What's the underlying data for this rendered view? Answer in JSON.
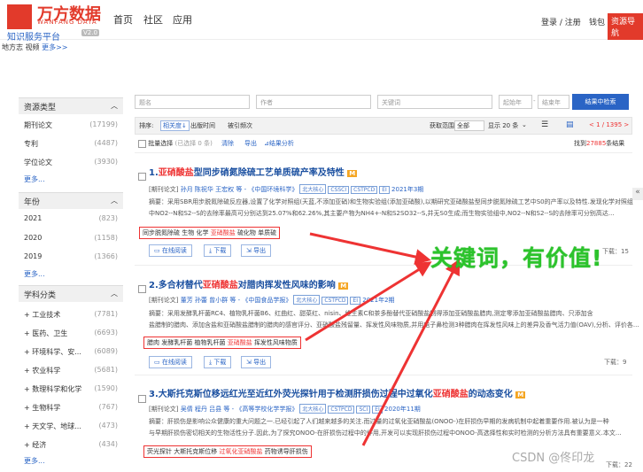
{
  "header": {
    "logo_main": "万方数据",
    "logo_sub": "WANFANG DATA",
    "platform": "知识服务平台",
    "version": "V2.0",
    "nav": [
      "首页",
      "社区",
      "应用"
    ],
    "login": "登录 / 注册",
    "wallet": "钱包",
    "guide": "资源导航"
  },
  "breadcrumb": {
    "text": "地方志 视频",
    "more": "更多>>"
  },
  "sidebar": {
    "resource_type": {
      "title": "资源类型",
      "items": [
        {
          "name": "期刊论文",
          "count": "(17199)"
        },
        {
          "name": "专利",
          "count": "(4487)"
        },
        {
          "name": "学位论文",
          "count": "(3930)"
        }
      ],
      "more": "更多..."
    },
    "year": {
      "title": "年份",
      "items": [
        {
          "name": "2021",
          "count": "(823)"
        },
        {
          "name": "2020",
          "count": "(1158)"
        },
        {
          "name": "2019",
          "count": "(1366)"
        }
      ],
      "more": "更多..."
    },
    "discipline": {
      "title": "学科分类",
      "items": [
        {
          "name": "+ 工业技术",
          "count": "(7781)"
        },
        {
          "name": "+ 医药、卫生",
          "count": "(6693)"
        },
        {
          "name": "+ 环境科学、安...",
          "count": "(6089)"
        },
        {
          "name": "+ 农业科学",
          "count": "(5681)"
        },
        {
          "name": "+ 数理科学和化学",
          "count": "(1590)"
        },
        {
          "name": "+ 生物科学",
          "count": "(767)"
        },
        {
          "name": "+ 天文学、地球...",
          "count": "(473)"
        },
        {
          "name": "+ 经济",
          "count": "(434)"
        }
      ],
      "more": "更多..."
    }
  },
  "search": {
    "title_ph": "题名",
    "author_ph": "作者",
    "keyword_ph": "关键词",
    "start_year_ph": "起始年",
    "end_year_ph": "结束年",
    "button": "结果中检索"
  },
  "toolbar": {
    "sort_label": "排序:",
    "sort_relevance": "相关度↓",
    "sort_date": "出版时间",
    "sort_cited": "被引频次",
    "fulltext": "获取范围",
    "fulltext_all": "全部",
    "display": "显示 20 条",
    "pager": "< 1 / 1395 >",
    "batch": "批量选择",
    "selected": "(已选择 0 条)",
    "clear": "清除",
    "export": "导出",
    "analysis": "结果分析",
    "found_pre": "找到",
    "found_count": "27885",
    "found_post": "条结果"
  },
  "results": [
    {
      "num": "1.",
      "title_hl": "亚硝酸盐",
      "title_rest": "型同步硝氮除硫工艺单质硫产率及特性",
      "meta_type": "[期刊论文]",
      "authors": "孙月  陈祝华  王宏权 等 - 《中国环境科学》",
      "tags": [
        "北大核心",
        "CSSCI",
        "CSTPCD",
        "EI"
      ],
      "date": "2021年3期",
      "abstract1": "摘要：采用SBR用步脱氮除硫反应器,设置了化学对照组(天蓝,不添加亚硝)和生物实验组(添加亚硝酸),以期研究亚硝酸盐型同步脱氮除硫工艺中S0的产率以及特性.发现化学对照组",
      "abstract2": "中NO2--N和S2--S的去除率最高可分别达到25.07%和62.26%,其主要产物为NH4+-N和S2SO32--S,并无S0生成;而生物实验组中,NO2--N和S2--S的去除率可分别高达...",
      "keywords": [
        "同步脱氮除硫",
        "生物",
        "化学",
        "亚硝酸盐",
        "硫化物",
        "单质硫"
      ],
      "kw_hl_index": 3,
      "online": "在线阅读",
      "download": "下载",
      "export": "导出",
      "downloads": "下载：15"
    },
    {
      "num": "2.",
      "title_hl": "",
      "title_pre": "多合材替代",
      "title_hl2": "亚硝酸盐",
      "title_rest": "对腊肉挥发性风味的影响",
      "meta_type": "[期刊论文]",
      "authors": "董芳  孙蕾  曾小群 等 - 《中国食品学报》",
      "tags": [
        "北大核心",
        "CSTPCD",
        "EI"
      ],
      "date": "2021年2期",
      "abstract1": "摘要：采用发酵乳杆菌RC4、植物乳杆菌B6、红曲红、甜菜红、nisin、维生素C和茶多酚替代亚硝酸盐制得添加亚硝酸盐腊肉,测定零添加亚硝酸盐腊肉、只添加含",
      "abstract2": "盐腊制的腊肉、添加含盐和亚硝酸盐腊制的腊肉的感官评分、亚硝酸盐残留量、挥发性风味物质,并用电子鼻检测3种腊肉在挥发性风味上的差异及香气活力值(OAV),分析、评价各...",
      "keywords": [
        "腊肉",
        "发酵乳杆菌",
        "植物乳杆菌",
        "亚硝酸盐",
        "挥发性风味物质"
      ],
      "kw_hl_index": 3,
      "online": "在线阅读",
      "download": "下载",
      "export": "导出",
      "downloads": "下载：9"
    },
    {
      "num": "3.",
      "title_pre": "大斯托克斯位移远红光至近红外荧光探针用于检测肝损伤过程中过氧化",
      "title_hl2": "亚硝酸盐",
      "title_rest": "的动态变化",
      "meta_type": "[期刊论文]",
      "authors": "吴倩  程丹  吕县 等 - 《高等学校化学学报》",
      "tags": [
        "北大核心",
        "CSTPCD",
        "SCI",
        "EI"
      ],
      "date": "2020年11期",
      "abstract1": "摘要：肝损伤是影响公众健康的重大问题之一.已经引起了人们越来越多的关注.而过量的过氧化亚硝酸盐(ONOO-)在肝损伤早期的发病机制中起着重要作用.被认为是一种",
      "abstract2": "与早期肝损伤密切相关的生物活性分子.因此,为了探究ONOO-在肝损伤过程中的作用,开发可以实现肝损伤过程中ONOO-高选择性和实时检测的分析方法具有重要意义.本文...",
      "keywords": [
        "荧光探针",
        "大斯托克斯位移",
        "过氧化亚硝酸盐",
        "药物诱导肝损伤"
      ],
      "kw_hl_index": 2,
      "online": "在线阅读",
      "download": "下载",
      "export": "导出",
      "downloads": "下载：22"
    }
  ],
  "annotation": "关键词，有价值!",
  "watermark": "CSDN @佟印龙",
  "colors": {
    "brand": "#e23a2b",
    "link": "#2a64c5",
    "highlight": "#e33333",
    "annotation": "#2cc32c"
  }
}
